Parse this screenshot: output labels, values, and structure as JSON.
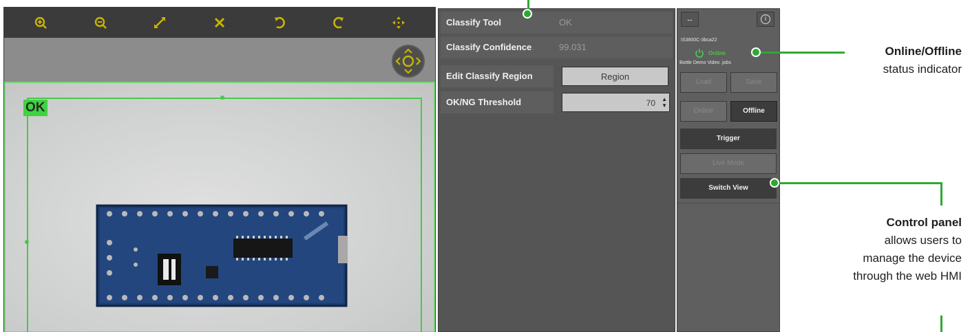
{
  "colors": {
    "accent_green": "#2fa832",
    "roi_green": "#48c848",
    "toolbar_icon_yellow": "#c9b400",
    "status_online_green": "#46c846"
  },
  "toolbar": {
    "icons": [
      "zoom-in-icon",
      "zoom-out-icon",
      "fit-diagonal-icon",
      "close-cross-icon",
      "rotate-ccw-icon",
      "rotate-cw-icon",
      "move-icon"
    ]
  },
  "viewer": {
    "result_tag": "OK"
  },
  "tool_panel": {
    "rows": [
      {
        "label": "Classify Tool",
        "value": "OK"
      },
      {
        "label": "Classify Confidence",
        "value": "99.031"
      },
      {
        "label": "Edit Classify Region",
        "button": "Region"
      },
      {
        "label": "OK/NG Threshold",
        "value": "70"
      }
    ]
  },
  "control_panel": {
    "top_left_btn": "↔",
    "info_btn": "i",
    "device_name": "IS3800C-3bca22",
    "status": "Online",
    "job_name": "Bottle Demo Video .jobs",
    "load": "Load",
    "save": "Save",
    "online": "Online",
    "offline": "Offline",
    "trigger": "Trigger",
    "live_mode": "Live Mode",
    "switch_view": "Switch View"
  },
  "callouts": {
    "online": {
      "title": "Online/Offline",
      "text": "status indicator"
    },
    "control": {
      "title": "Control panel",
      "lines": [
        "allows users to",
        "manage the device",
        "through the web HMI"
      ]
    }
  }
}
